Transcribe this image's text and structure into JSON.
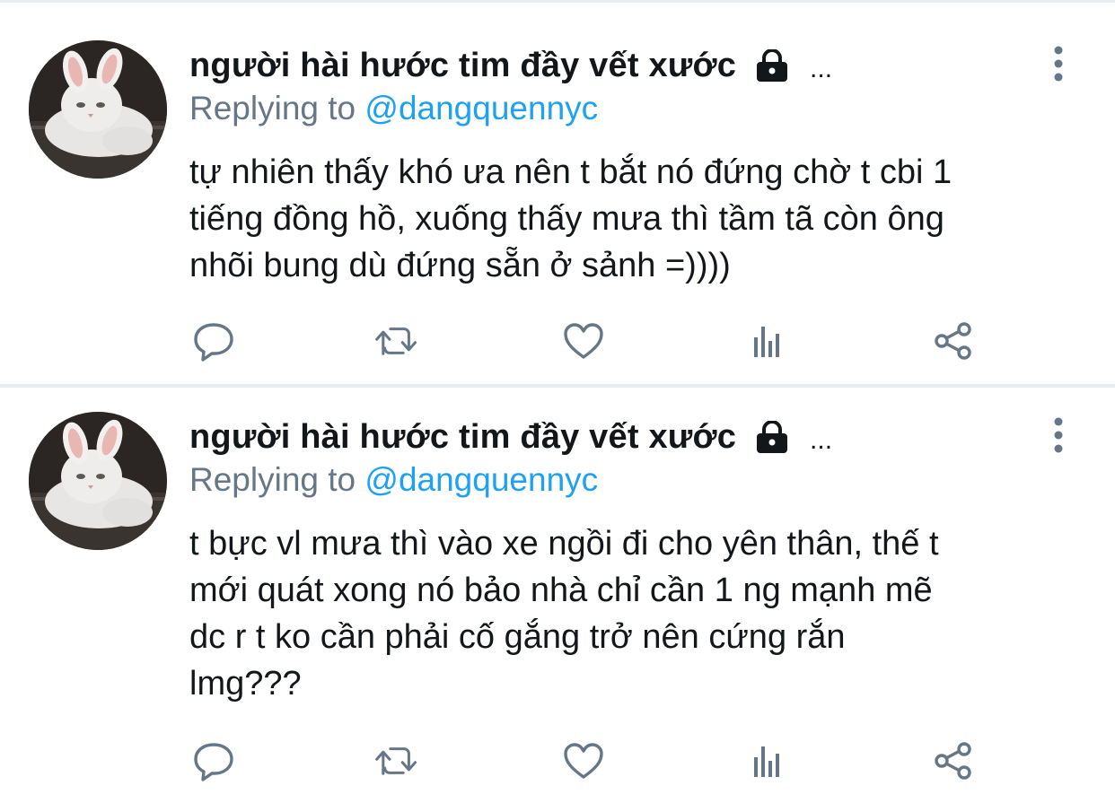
{
  "tweets": [
    {
      "display_name": "người hài hước tim đầy vết xước",
      "locked_icon": "lock-icon",
      "name_overflow": "...",
      "replying_label": "Replying to",
      "replying_handle": "@dangquennyc",
      "text_lines": [
        "tự nhiên thấy khó ưa nên t bắt nó đứng chờ t cbi 1",
        "tiếng đồng hồ, xuống thấy mưa thì tầm tã còn ông",
        "nhõi bung dù đứng sẵn ở sảnh =))))"
      ]
    },
    {
      "display_name": "người hài hước tim đầy vết xước",
      "locked_icon": "lock-icon",
      "name_overflow": "...",
      "replying_label": "Replying to",
      "replying_handle": "@dangquennyc",
      "text_lines": [
        "t bực vl mưa thì vào xe ngồi đi cho yên thân, thế t",
        "mới quát xong nó bảo nhà chỉ cần 1 ng mạnh mẽ",
        "dc r t ko cần phải cố gắng trở nên cứng rắn",
        "lmg???"
      ]
    }
  ],
  "action_icons": [
    "reply-icon",
    "retweet-icon",
    "like-icon",
    "stats-icon",
    "share-icon"
  ],
  "colors": {
    "text": "#14171a",
    "secondary": "#657786",
    "link": "#1da1f2",
    "icon": "#657786",
    "divider": "#e6ecf0"
  }
}
